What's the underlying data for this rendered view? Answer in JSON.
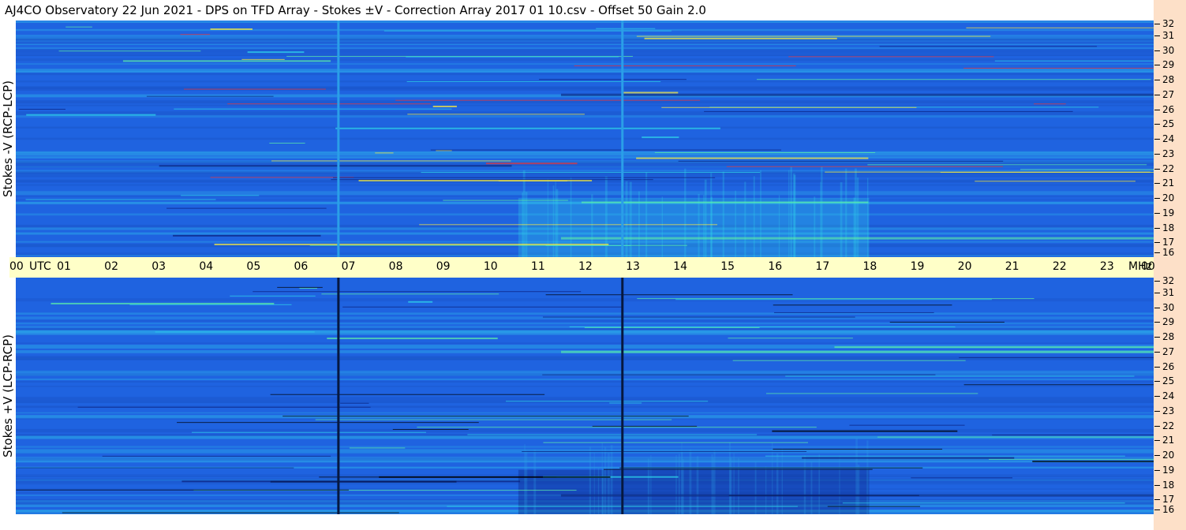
{
  "header": {
    "title": "AJ4CO Observatory  22 Jun 2021  -  DPS on TFD Array  -  Stokes ±V  -  Correction Array 2017 01 10.csv  -  Offset 50  Gain 2.0"
  },
  "colors": {
    "background_blue": "#1f63e0",
    "light_blue": "#2a9fe8",
    "dark_blue": "#0a1f7a",
    "cyan": "#2fd7ea",
    "green": "#5ef2a6",
    "yellow": "#ffef3a",
    "red": "#e33",
    "time_axis_bg": "#ffffc8",
    "freq_axis_bg": "#fde0c8"
  },
  "chart_data": [
    {
      "type": "heatmap",
      "ylabel": "Stokes -V (RCP-LCP)",
      "xlabel": "UTC",
      "x_unit": "UTC",
      "y_unit": "MHz",
      "x_ticks": [
        "00",
        "01",
        "02",
        "03",
        "04",
        "05",
        "06",
        "07",
        "08",
        "09",
        "10",
        "11",
        "12",
        "13",
        "14",
        "15",
        "16",
        "17",
        "18",
        "19",
        "20",
        "21",
        "22",
        "23",
        "00"
      ],
      "y_ticks": [
        32,
        31,
        30,
        29,
        28,
        27,
        26,
        25,
        24,
        23,
        22,
        21,
        20,
        19,
        18,
        17,
        16
      ],
      "xlim": [
        0,
        24
      ],
      "ylim": [
        16,
        32
      ],
      "vertical_lines_utc": [
        6.78,
        12.77
      ],
      "vertical_line_color": "light",
      "burst_region_utc": [
        10.6,
        18.0
      ],
      "burst_region_mhz": [
        16,
        20
      ]
    },
    {
      "type": "heatmap",
      "ylabel": "Stokes +V (LCP-RCP)",
      "xlabel": "UTC",
      "x_unit": "UTC",
      "y_unit": "MHz",
      "x_ticks": [
        "00",
        "01",
        "02",
        "03",
        "04",
        "05",
        "06",
        "07",
        "08",
        "09",
        "10",
        "11",
        "12",
        "13",
        "14",
        "15",
        "16",
        "17",
        "18",
        "19",
        "20",
        "21",
        "22",
        "23",
        "00"
      ],
      "y_ticks": [
        32,
        31,
        30,
        29,
        28,
        27,
        26,
        25,
        24,
        23,
        22,
        21,
        20,
        19,
        18,
        17,
        16
      ],
      "xlim": [
        0,
        24
      ],
      "ylim": [
        16,
        32
      ],
      "vertical_lines_utc": [
        6.78,
        12.77
      ],
      "vertical_line_color": "dark",
      "burst_region_utc": [
        10.6,
        18.0
      ],
      "burst_region_mhz": [
        16,
        19
      ]
    }
  ],
  "time_axis": {
    "utc_label": "UTC",
    "mhz_label": "MHz"
  }
}
